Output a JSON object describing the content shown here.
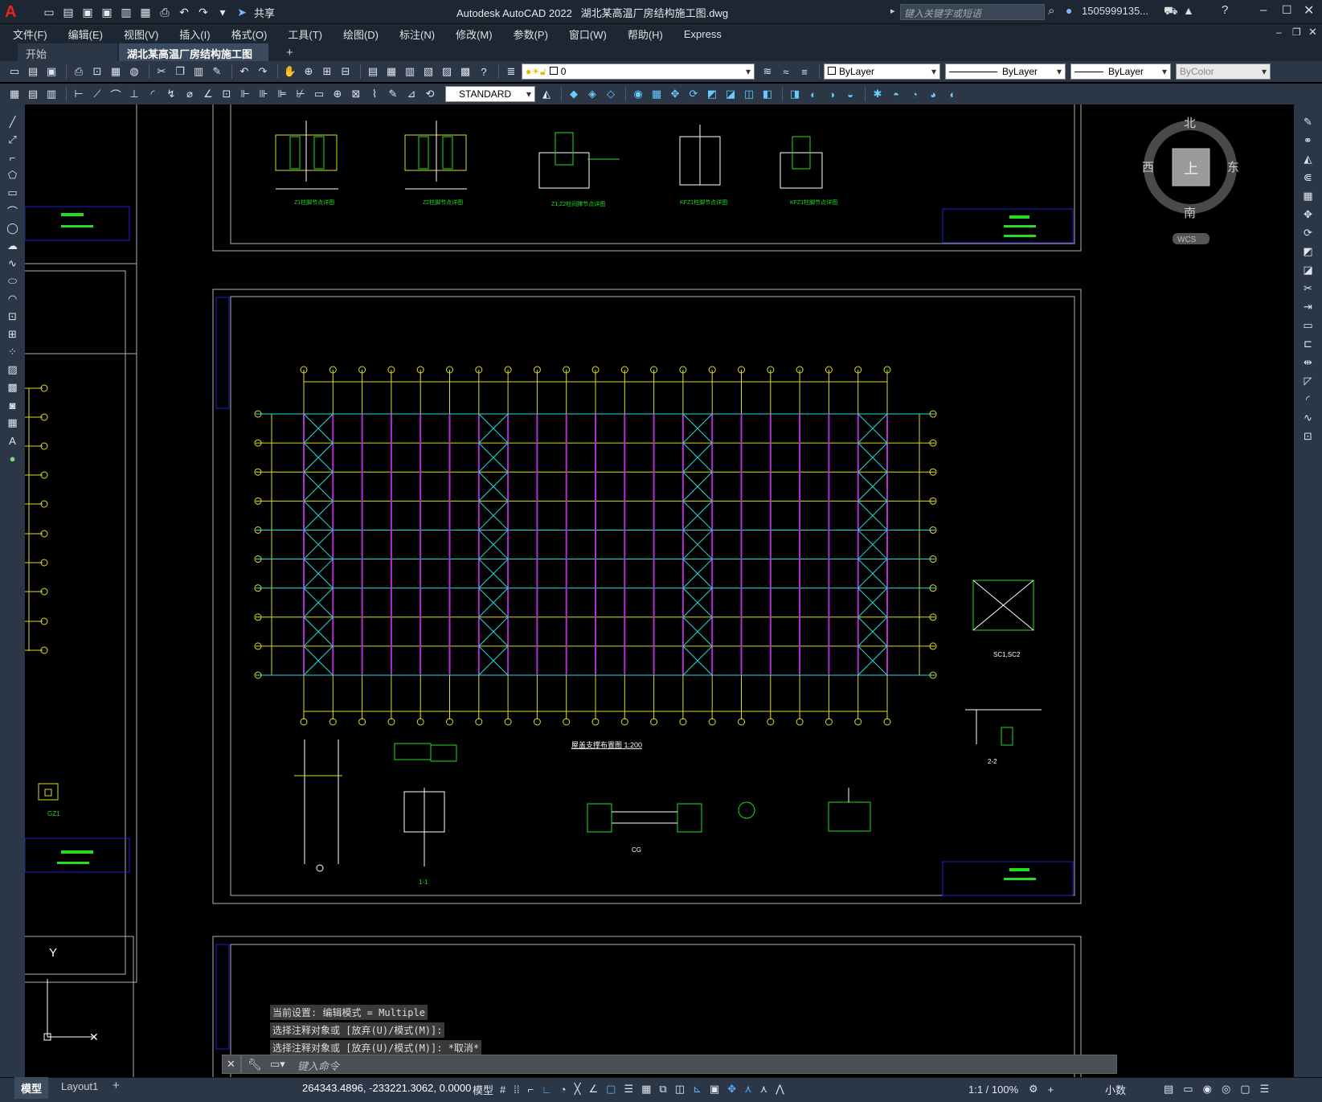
{
  "app": {
    "logo": "A",
    "title": "Autodesk AutoCAD 2022",
    "filename": "湖北某高温厂房结构施工图.dwg",
    "share": "共享",
    "search_placeholder": "键入关键字或短语",
    "user": "1505999135..."
  },
  "menu": [
    "文件(F)",
    "编辑(E)",
    "视图(V)",
    "插入(I)",
    "格式(O)",
    "工具(T)",
    "绘图(D)",
    "标注(N)",
    "修改(M)",
    "参数(P)",
    "窗口(W)",
    "帮助(H)",
    "Express"
  ],
  "tabs": {
    "start": "开始",
    "doc": "湖北某高温厂房结构施工图*",
    "add": "+"
  },
  "toolbar": {
    "layer": "0",
    "textstyle": "STANDARD",
    "color": "ByLayer",
    "linetype": "ByLayer",
    "lineweight": "ByLayer",
    "plotstyle": "ByColor"
  },
  "viewcube": {
    "north": "北",
    "south": "南",
    "east": "东",
    "west": "西",
    "top": "上",
    "wcs": "WCS"
  },
  "drawing": {
    "detail_labels": [
      "Z1柱脚节点详图",
      "Z2柱脚节点详图",
      "Z1,Z2柱间撑节点详图",
      "KFZ1柱脚节点详图",
      "KFZ1柱脚节点详图"
    ],
    "plan_title": "屋盖支撑布置图 1:200",
    "sc_label": "SC1,SC2",
    "section_22": "2-2",
    "section_11": "1-1",
    "cg_label": "CG",
    "gz_label": "GZ1",
    "axis_y_label": "Y"
  },
  "command": {
    "history": [
      "当前设置: 编辑模式 = Multiple",
      "选择注释对象或 [放弃(U)/模式(M)]:",
      "选择注释对象或 [放弃(U)/模式(M)]: *取消*"
    ],
    "placeholder": "键入命令"
  },
  "status": {
    "model_tab": "模型",
    "layout_tab": "Layout1",
    "coords": "264343.4896, -233221.3062, 0.0000",
    "model": "模型",
    "scale": "1:1 / 100%",
    "units": "小数"
  }
}
